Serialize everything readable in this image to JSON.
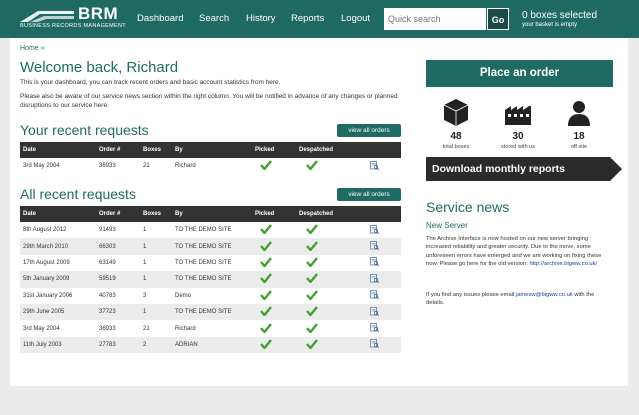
{
  "header": {
    "logo_text": "BRM",
    "logo_sub": "BUSINESS RECORDS MANAGEMENT",
    "nav": [
      "Dashboard",
      "Search",
      "History",
      "Reports",
      "Logout"
    ],
    "search_placeholder": "Quick search",
    "go_label": "Go",
    "basket_title": "0 boxes selected",
    "basket_sub": "your basket is empty"
  },
  "breadcrumb": "Home »",
  "welcome": "Welcome back, Richard",
  "intro1": "This is your dashboard, you can track recent orders and basic account statistics from here.",
  "intro2": "Please also be aware of our service news section within the right column. You will be notified in advance of any changes or planned disruptions to our service here.",
  "recent": {
    "title": "Your recent requests",
    "view_all": "view all orders",
    "headers": [
      "Date",
      "Order #",
      "Boxes",
      "By",
      "Picked",
      "Despatched"
    ],
    "rows": [
      {
        "date": "3rd May 2004",
        "order": "36933",
        "boxes": "21",
        "by": "Richard"
      }
    ]
  },
  "all_recent": {
    "title": "All recent requests",
    "view_all": "view all orders",
    "headers": [
      "Date",
      "Order #",
      "Boxes",
      "By",
      "Picked",
      "Despatched"
    ],
    "rows": [
      {
        "date": "8th August 2012",
        "order": "91493",
        "boxes": "1",
        "by": "TO THE DEMO SITE"
      },
      {
        "date": "29th March 2010",
        "order": "66303",
        "boxes": "1",
        "by": "TO THE DEMO SITE"
      },
      {
        "date": "17th August 2009",
        "order": "63149",
        "boxes": "1",
        "by": "TO THE DEMO SITE"
      },
      {
        "date": "5th January 2009",
        "order": "59519",
        "boxes": "1",
        "by": "TO THE DEMO SITE"
      },
      {
        "date": "31st January 2006",
        "order": "40783",
        "boxes": "3",
        "by": "Demo"
      },
      {
        "date": "29th June 2005",
        "order": "37723",
        "boxes": "1",
        "by": "TO THE DEMO SITE"
      },
      {
        "date": "3rd May 2004",
        "order": "36933",
        "boxes": "21",
        "by": "Richard"
      },
      {
        "date": "11th July 2003",
        "order": "27783",
        "boxes": "2",
        "by": "ADRIAN"
      }
    ]
  },
  "sidebar": {
    "place_order": "Place an order",
    "stats": [
      {
        "value": "48",
        "label": "total boxes",
        "icon": "box-icon"
      },
      {
        "value": "30",
        "label": "stored with us",
        "icon": "warehouse-icon"
      },
      {
        "value": "18",
        "label": "off site",
        "icon": "person-icon"
      }
    ],
    "download": "Download monthly reports",
    "service_title": "Service news",
    "service_sub": "New Server",
    "service_text": "The Archive Interface is now hosted on our new server bringing increased reliability and greater security. Due to the move, some unforeseen errors have emerged and we are working on fixing these now. Please go here for the old version:",
    "service_link": "http://archive.bigww.co.uk/",
    "service_text2": "If you find any issues please email",
    "service_email": "jamesw@bigww.co.uk",
    "service_text3": "with the details."
  },
  "colors": {
    "brand": "#1f6b63",
    "table_header": "#333333",
    "tick": "#4a9e2f"
  }
}
